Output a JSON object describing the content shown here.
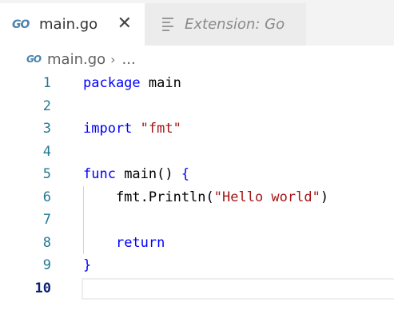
{
  "tabs": [
    {
      "icon": "go-file-icon",
      "icon_text": "GO",
      "label": "main.go",
      "close": "✕",
      "active": true
    },
    {
      "icon": "preview-icon",
      "label": "Extension: Go",
      "active": false
    }
  ],
  "breadcrumb": {
    "icon_text": "GO",
    "file": "main.go",
    "separator": "›",
    "more": "..."
  },
  "editor": {
    "current_line": 10,
    "lines": [
      {
        "n": "1",
        "tokens": [
          {
            "t": "package",
            "c": "kw"
          },
          {
            "t": " main",
            "c": "fn"
          }
        ]
      },
      {
        "n": "2",
        "tokens": []
      },
      {
        "n": "3",
        "tokens": [
          {
            "t": "import",
            "c": "kw"
          },
          {
            "t": " ",
            "c": "fn"
          },
          {
            "t": "\"fmt\"",
            "c": "str"
          }
        ]
      },
      {
        "n": "4",
        "tokens": []
      },
      {
        "n": "5",
        "tokens": [
          {
            "t": "func",
            "c": "kw"
          },
          {
            "t": " main() ",
            "c": "fn"
          },
          {
            "t": "{",
            "c": "kw"
          }
        ]
      },
      {
        "n": "6",
        "tokens": [
          {
            "t": "    fmt.Println(",
            "c": "fn"
          },
          {
            "t": "\"Hello world\"",
            "c": "str"
          },
          {
            "t": ")",
            "c": "fn"
          }
        ]
      },
      {
        "n": "7",
        "tokens": []
      },
      {
        "n": "8",
        "tokens": [
          {
            "t": "    ",
            "c": "fn"
          },
          {
            "t": "return",
            "c": "kw"
          }
        ]
      },
      {
        "n": "9",
        "tokens": [
          {
            "t": "}",
            "c": "kw"
          }
        ]
      },
      {
        "n": "10",
        "tokens": []
      }
    ]
  },
  "colors": {
    "keyword": "#0000ff",
    "string": "#a31515",
    "line_number": "#237893",
    "go_icon": "#4a83ad"
  }
}
